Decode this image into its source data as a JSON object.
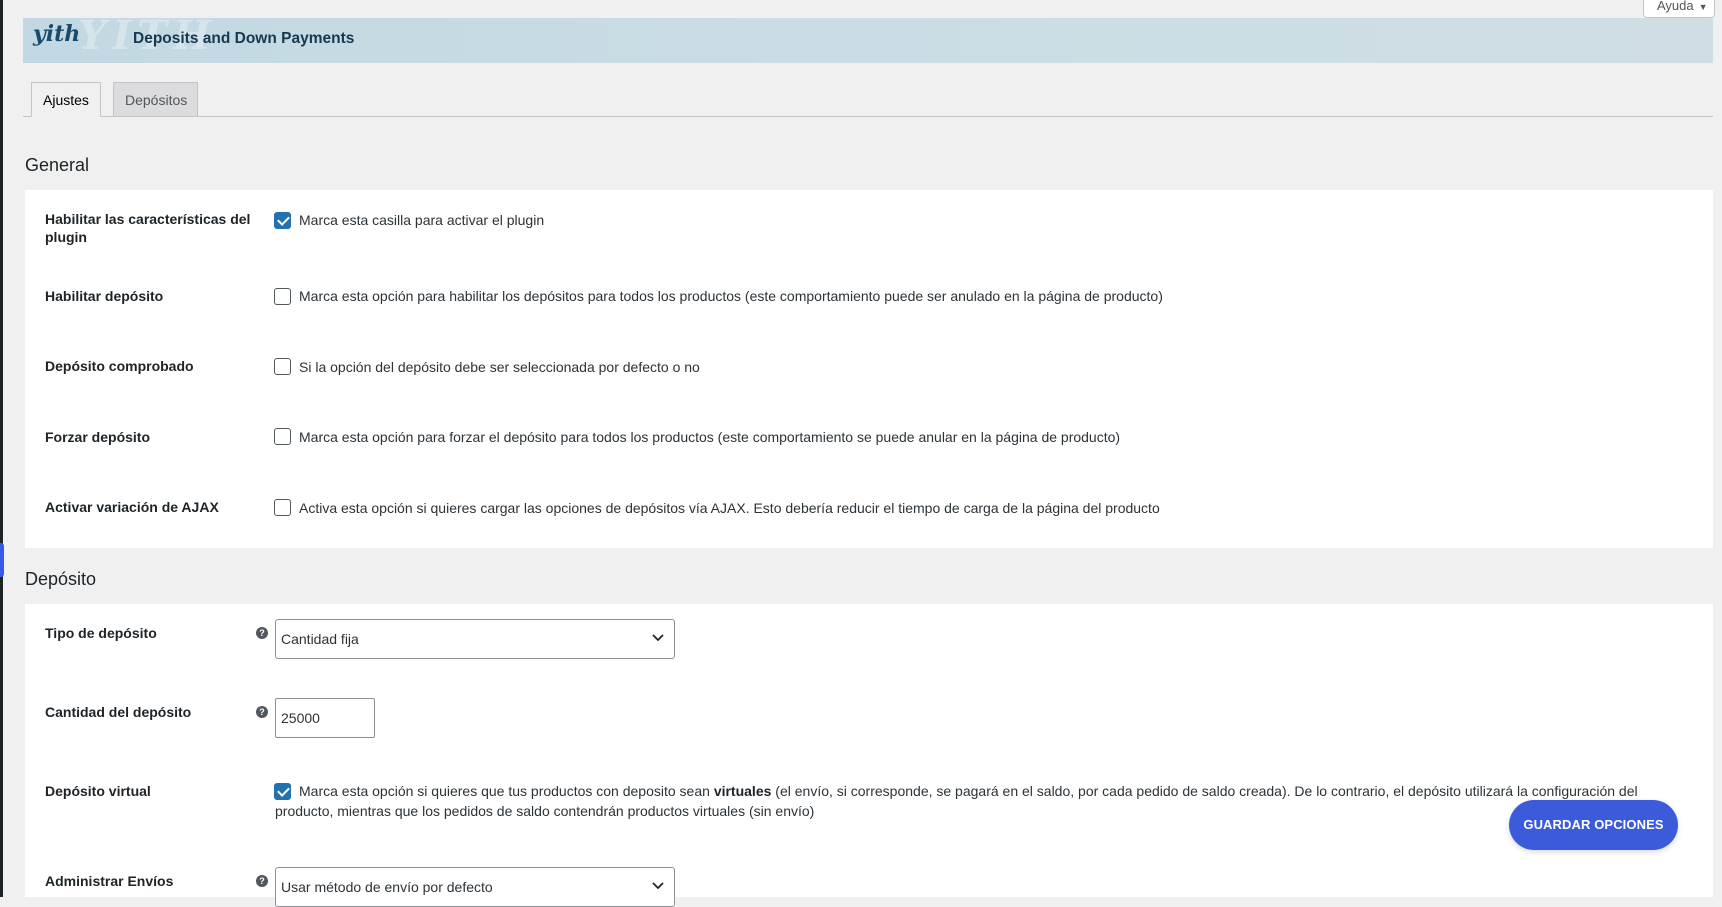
{
  "help_tab": {
    "label": "Ayuda"
  },
  "header": {
    "logo": "yith",
    "watermark": "YITH",
    "title": "Deposits and Down Payments"
  },
  "tabs": [
    {
      "label": "Ajustes",
      "active": true
    },
    {
      "label": "Depósitos",
      "active": false
    }
  ],
  "general": {
    "title": "General",
    "rows": [
      {
        "label": "Habilitar las características del plugin",
        "checked": true,
        "text": "Marca esta casilla para activar el plugin"
      },
      {
        "label": "Habilitar depósito",
        "checked": false,
        "text": "Marca esta opción para habilitar los depósitos para todos los productos (este comportamiento puede ser anulado en la página de producto)"
      },
      {
        "label": "Depósito comprobado",
        "checked": false,
        "text": "Si la opción del depósito debe ser seleccionada por defecto o no"
      },
      {
        "label": "Forzar depósito",
        "checked": false,
        "text": "Marca esta opción para forzar el depósito para todos los productos (este comportamiento se puede anular en la página de producto)"
      },
      {
        "label": "Activar variación de AJAX",
        "checked": false,
        "text": "Activa esta opción si quieres cargar las opciones de depósitos vía AJAX. Esto debería reducir el tiempo de carga de la página del producto"
      }
    ]
  },
  "deposit": {
    "title": "Depósito",
    "type": {
      "label": "Tipo de depósito",
      "value": "Cantidad fija"
    },
    "amount": {
      "label": "Cantidad del depósito",
      "value": "25000"
    },
    "virtual": {
      "label": "Depósito virtual",
      "checked": true,
      "text_before": "Marca esta opción si quieres que tus productos con deposito sean ",
      "text_bold": "virtuales",
      "text_after": " (el envío, si corresponde, se pagará en el saldo, por cada pedido de saldo creada). De lo contrario, el depósito utilizará la configuración del producto, mientras que los pedidos de saldo contendrán productos virtuales (sin envío)"
    },
    "shipping": {
      "label": "Administrar Envíos",
      "value": "Usar método de envío por defecto"
    }
  },
  "save_button": {
    "label": "GUARDAR OPCIONES"
  },
  "colors": {
    "accent": "#3b5bdb",
    "checkbox": "#2271b1",
    "banner": "#c9dce5"
  }
}
